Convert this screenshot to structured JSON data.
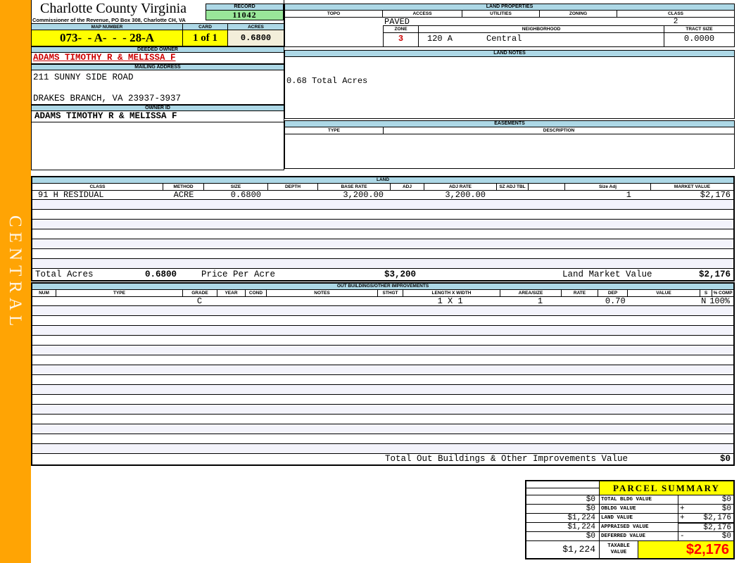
{
  "header": {
    "county": "Charlotte County Virginia",
    "commissioner": "Commissioner of the Revenue, PO Box 308, Charlotte CH, VA",
    "record_label": "RECORD",
    "record_value": "11042",
    "map_number_label": "MAP NUMBER",
    "map_number_value": "073-  - A-  -  - 28-A",
    "card_label": "CARD",
    "card_value": "1 of 1",
    "acres_label": "ACRES",
    "acres_value": "0.6800"
  },
  "owner": {
    "deeded_owner_label": "DEEDED OWNER",
    "deeded_owner": "ADAMS TIMOTHY R & MELISSA F",
    "mailing_address_label": "MAILING ADDRESS",
    "address_line1": "211 SUNNY SIDE ROAD",
    "address_line2": "DRAKES BRANCH, VA 23937-3937",
    "owner_id_label": "OWNER ID",
    "owner_id": "ADAMS TIMOTHY R & MELISSA F"
  },
  "sidebar": {
    "district": "CENTRAL"
  },
  "land_properties": {
    "title": "LAND PROPERTIES",
    "topo_label": "TOPO",
    "access_label": "ACCESS",
    "utilities_label": "UTILITIES",
    "zoning_label": "ZONING",
    "class_label": "CLASS",
    "access_value": "PAVED",
    "class_value": "2",
    "zone_label": "ZONE",
    "neighborhood_label": "NEIGHBORHOOD",
    "tract_size_label": "TRACT SIZE",
    "zone_value": "3",
    "neighborhood_code": "120 A",
    "neighborhood_name": "Central",
    "tract_size_value": "0.0000"
  },
  "land_notes": {
    "title": "LAND NOTES",
    "note": "0.68 Total Acres"
  },
  "easements": {
    "title": "EASEMENTS",
    "type_label": "TYPE",
    "description_label": "DESCRIPTION"
  },
  "land": {
    "title": "LAND",
    "columns": [
      "CLASS",
      "METHOD",
      "SIZE",
      "DEPTH",
      "BASE RATE",
      "ADJ",
      "ADJ RATE",
      "SZ ADJ TBL",
      "",
      "Size Adj",
      "MARKET VALUE"
    ],
    "rows": [
      [
        "91 H RESIDUAL",
        "ACRE",
        "0.6800",
        "",
        "3,200.00",
        "",
        "3,200.00",
        "",
        "",
        "1",
        "$2,176"
      ]
    ],
    "totals": {
      "total_acres_label": "Total Acres",
      "total_acres": "0.6800",
      "price_per_acre_label": "Price Per Acre",
      "price_per_acre": "$3,200",
      "market_value_label": "Land Market Value",
      "market_value": "$2,176"
    }
  },
  "out_buildings": {
    "title": "OUT BUILDINGS/OTHER IMPROVEMENTS",
    "columns": [
      "NUM",
      "TYPE",
      "GRADE",
      "YEAR",
      "COND",
      "NOTES",
      "STHGT",
      "LENGTH X WIDTH",
      "AREA/SIZE",
      "RATE",
      "DEP",
      "VALUE",
      "S",
      "% COMP"
    ],
    "rows": [
      [
        "",
        "",
        "C",
        "",
        "",
        "",
        "",
        "1 X 1",
        "1",
        "",
        "0.70",
        "",
        "N",
        "100%"
      ]
    ],
    "total_label": "Total Out Buildings & Other Improvements Value",
    "total_value": "$0"
  },
  "parcel_summary": {
    "title": "PARCEL SUMMARY",
    "rows": [
      {
        "prior": "$0",
        "label": "TOTAL BLDG VALUE",
        "op": "",
        "value": "$0"
      },
      {
        "prior": "$0",
        "label": "OBLDG VALUE",
        "op": "+",
        "value": "$0"
      },
      {
        "prior": "$1,224",
        "label": "LAND VALUE",
        "op": "+",
        "value": "$2,176"
      },
      {
        "prior": "$1,224",
        "label": "APPRAISED VALUE",
        "op": "",
        "value": "$2,176"
      },
      {
        "prior": "$0",
        "label": "DEFERRED VALUE",
        "op": "-",
        "value": "$0"
      }
    ],
    "taxable": {
      "prior": "$1,224",
      "label": "TAXABLE VALUE",
      "value": "$2,176"
    }
  },
  "colors": {
    "accent_blue": "#ADD8E6",
    "record_green": "#99E699",
    "highlight_yellow": "#FFFF00",
    "acres_beige": "#F3EEDA",
    "sidebar_orange": "#FFA404",
    "owner_red": "#CC0000",
    "taxable_red": "#FF0000",
    "alt_row": "#F3F3FB"
  }
}
